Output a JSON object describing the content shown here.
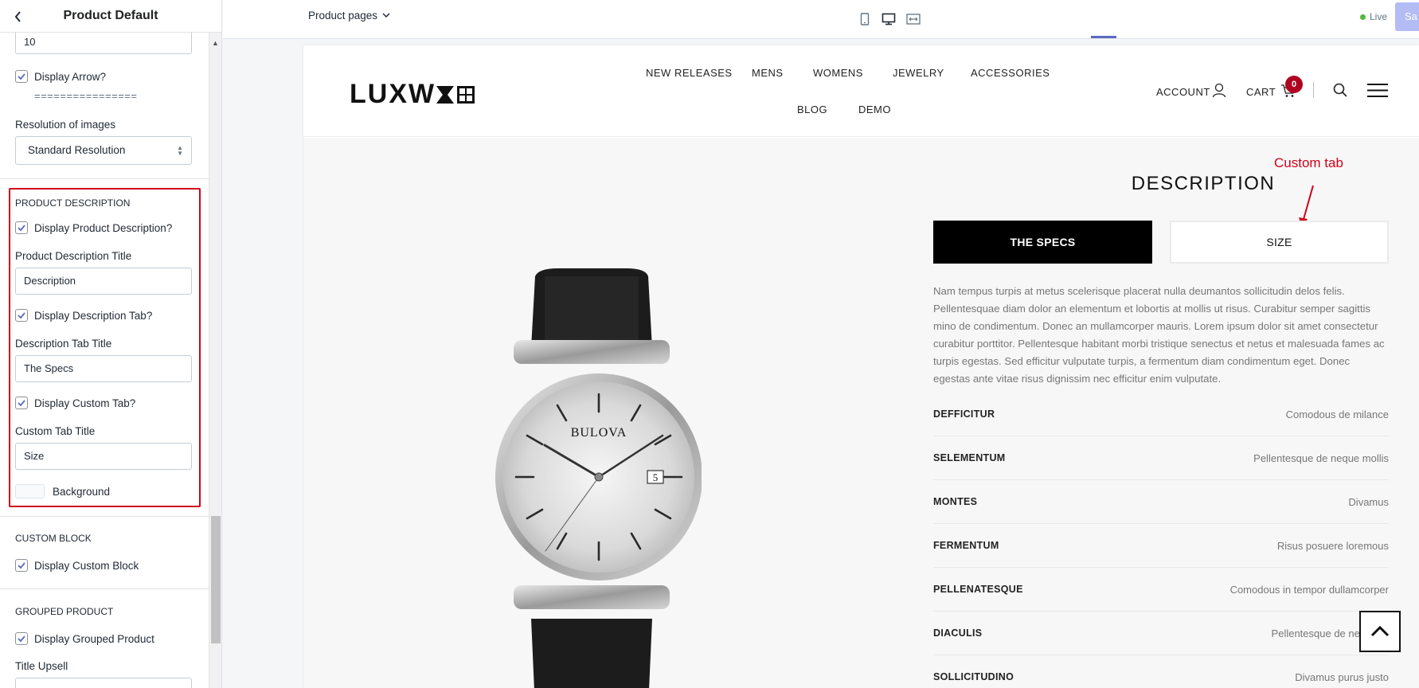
{
  "sidebar": {
    "title": "Product Default",
    "top_input_value": "10",
    "display_arrow_label": "Display Arrow?",
    "separator_text": "================",
    "resolution_label": "Resolution of images",
    "resolution_value": "Standard Resolution",
    "product_description": {
      "heading": "PRODUCT DESCRIPTION",
      "display_desc_label": "Display Product Description?",
      "desc_title_label": "Product Description Title",
      "desc_title_value": "Description",
      "display_desc_tab_label": "Display Description Tab?",
      "desc_tab_title_label": "Description Tab Title",
      "desc_tab_title_value": "The Specs",
      "display_custom_tab_label": "Display Custom Tab?",
      "custom_tab_title_label": "Custom Tab Title",
      "custom_tab_title_value": "Size",
      "background_label": "Background"
    },
    "custom_block": {
      "heading": "CUSTOM BLOCK",
      "display_label": "Display Custom Block"
    },
    "grouped_product": {
      "heading": "GROUPED PRODUCT",
      "display_label": "Display Grouped Product",
      "title_upsell_label": "Title Upsell"
    }
  },
  "topbar": {
    "pages_label": "Product pages",
    "live_label": "Live",
    "save_label": "Sa"
  },
  "store": {
    "logo_text": "LUXW",
    "nav": [
      "NEW RELEASES",
      "MENS",
      "WOMENS",
      "JEWELRY",
      "ACCESSORIES",
      "BLOG",
      "DEMO"
    ],
    "account_label": "ACCOUNT",
    "cart_label": "CART",
    "cart_count": "0",
    "description_heading": "DESCRIPTION",
    "tab_specs": "THE SPECS",
    "tab_size": "SIZE",
    "annotation": "Custom tab",
    "watch_brand": "BULOVA",
    "watch_date": "5",
    "description_text": "Nam tempus turpis at metus scelerisque placerat nulla deumantos sollicitudin delos felis. Pellentesquae diam dolor an elementum et lobortis at mollis ut risus. Curabitur semper sagittis mino de condimentum. Donec an mullamcorper mauris. Lorem ipsum dolor sit amet consectetur curabitur porttitor. Pellentesque habitant morbi tristique senectus et netus et malesuada fames ac turpis egestas. Sed efficitur vulputate turpis, a fermentum diam condimentum eget. Donec egestas ante vitae risus dignissim nec efficitur enim vulputate.",
    "specs": [
      {
        "key": "DEFFICITUR",
        "value": "Comodous de milance"
      },
      {
        "key": "SELEMENTUM",
        "value": "Pellentesque de neque mollis"
      },
      {
        "key": "MONTES",
        "value": "Divamus"
      },
      {
        "key": "FERMENTUM",
        "value": "Risus posuere loremous"
      },
      {
        "key": "PELLENATESQUE",
        "value": "Comodous in tempor dullamcorper"
      },
      {
        "key": "DIACULIS",
        "value": "Pellentesque de neque m"
      },
      {
        "key": "SOLLICITUDINO",
        "value": "Divamus purus justo"
      }
    ]
  }
}
